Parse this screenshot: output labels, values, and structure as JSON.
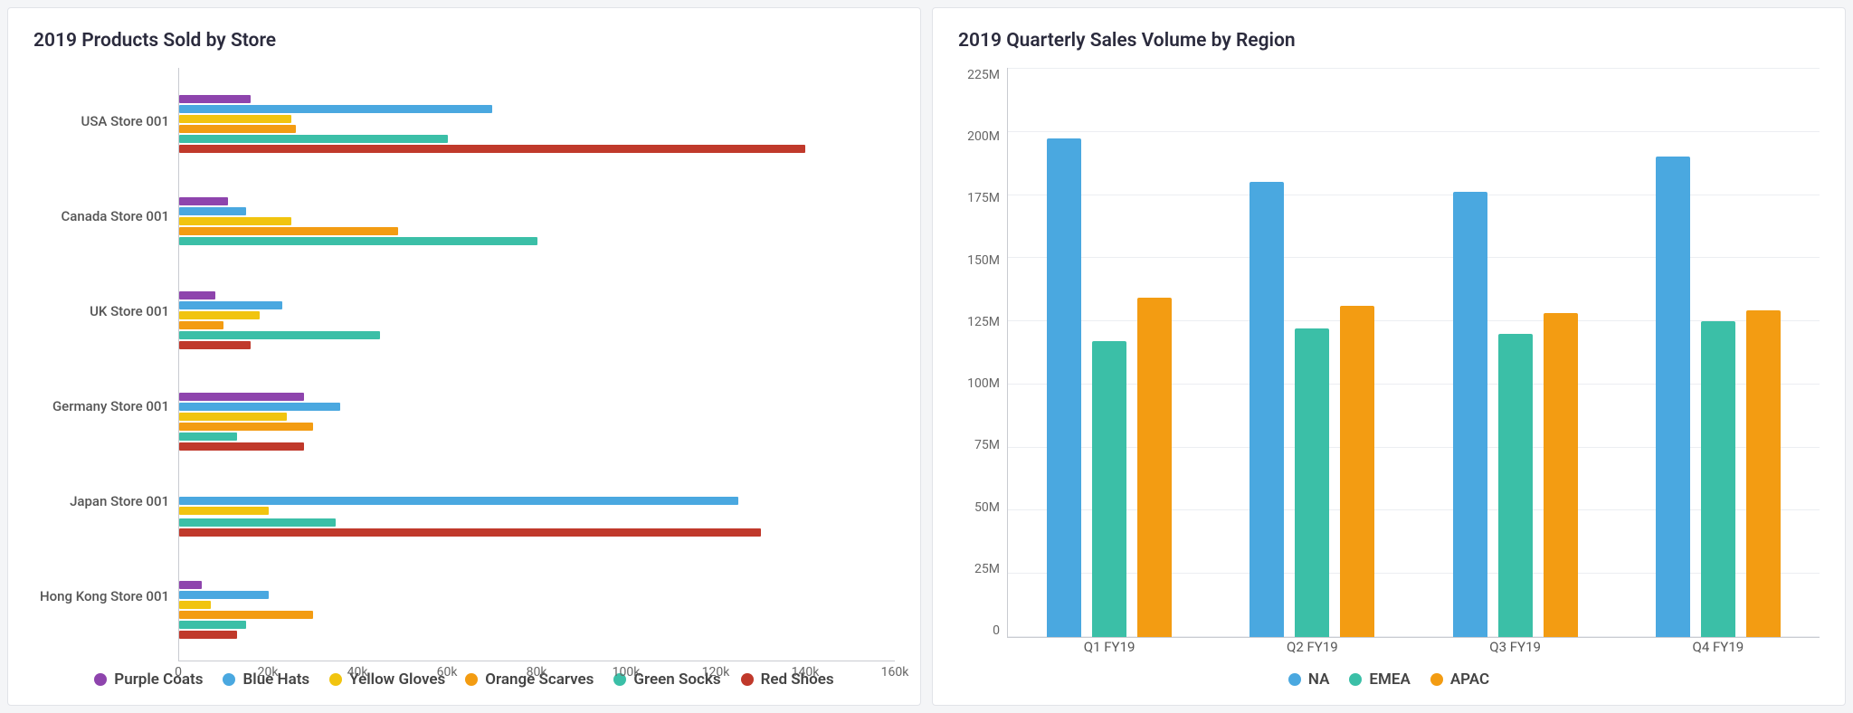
{
  "left": {
    "title": "2019 Products Sold by Store",
    "legend": [
      {
        "label": "Purple Coats",
        "color": "#8e44ad"
      },
      {
        "label": "Blue Hats",
        "color": "#4aa8e0"
      },
      {
        "label": "Yellow Gloves",
        "color": "#f1c40f"
      },
      {
        "label": "Orange Scarves",
        "color": "#f39c12"
      },
      {
        "label": "Green Socks",
        "color": "#3bbfa7"
      },
      {
        "label": "Red Shoes",
        "color": "#c0392b"
      }
    ],
    "xticks": [
      "0",
      "20k",
      "40k",
      "60k",
      "80k",
      "100k",
      "120k",
      "140k",
      "160k"
    ]
  },
  "right": {
    "title": "2019 Quarterly Sales Volume by Region",
    "legend": [
      {
        "label": "NA",
        "color": "#4aa8e0"
      },
      {
        "label": "EMEA",
        "color": "#3bbfa7"
      },
      {
        "label": "APAC",
        "color": "#f39c12"
      }
    ],
    "yticks": [
      "225M",
      "200M",
      "175M",
      "150M",
      "125M",
      "100M",
      "75M",
      "50M",
      "25M",
      "0"
    ]
  },
  "chart_data": [
    {
      "type": "bar",
      "orientation": "horizontal",
      "title": "2019 Products Sold by Store",
      "xlabel": "",
      "ylabel": "",
      "xlim": [
        0,
        160000
      ],
      "categories": [
        "USA Store 001",
        "Canada Store 001",
        "UK Store 001",
        "Germany Store 001",
        "Japan Store 001",
        "Hong Kong Store 001"
      ],
      "series": [
        {
          "name": "Purple Coats",
          "color": "#8e44ad",
          "values": [
            16000,
            11000,
            8000,
            28000,
            0,
            5000
          ]
        },
        {
          "name": "Blue Hats",
          "color": "#4aa8e0",
          "values": [
            70000,
            15000,
            23000,
            36000,
            125000,
            20000
          ]
        },
        {
          "name": "Yellow Gloves",
          "color": "#f1c40f",
          "values": [
            25000,
            25000,
            18000,
            24000,
            20000,
            7000
          ]
        },
        {
          "name": "Orange Scarves",
          "color": "#f39c12",
          "values": [
            26000,
            49000,
            10000,
            30000,
            0,
            30000
          ]
        },
        {
          "name": "Green Socks",
          "color": "#3bbfa7",
          "values": [
            60000,
            80000,
            45000,
            13000,
            35000,
            15000
          ]
        },
        {
          "name": "Red Shoes",
          "color": "#c0392b",
          "values": [
            140000,
            0,
            16000,
            28000,
            130000,
            13000
          ]
        }
      ]
    },
    {
      "type": "bar",
      "orientation": "vertical",
      "title": "2019 Quarterly Sales Volume by Region",
      "xlabel": "",
      "ylabel": "",
      "ylim": [
        0,
        225000000
      ],
      "categories": [
        "Q1 FY19",
        "Q2 FY19",
        "Q3 FY19",
        "Q4 FY19"
      ],
      "series": [
        {
          "name": "NA",
          "color": "#4aa8e0",
          "values": [
            197000000,
            180000000,
            176000000,
            190000000
          ]
        },
        {
          "name": "EMEA",
          "color": "#3bbfa7",
          "values": [
            117000000,
            122000000,
            120000000,
            125000000
          ]
        },
        {
          "name": "APAC",
          "color": "#f39c12",
          "values": [
            134000000,
            131000000,
            128000000,
            129000000
          ]
        }
      ]
    }
  ]
}
